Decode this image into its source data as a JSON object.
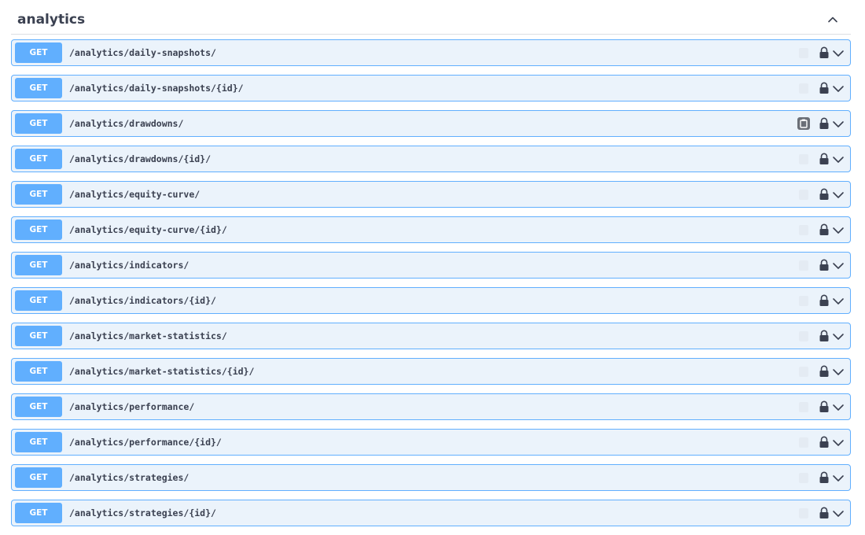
{
  "section": {
    "title": "analytics"
  },
  "operations": [
    {
      "method": "GET",
      "path": "/analytics/daily-snapshots/"
    },
    {
      "method": "GET",
      "path": "/analytics/daily-snapshots/{id}/"
    },
    {
      "method": "GET",
      "path": "/analytics/drawdowns/"
    },
    {
      "method": "GET",
      "path": "/analytics/drawdowns/{id}/"
    },
    {
      "method": "GET",
      "path": "/analytics/equity-curve/"
    },
    {
      "method": "GET",
      "path": "/analytics/equity-curve/{id}/"
    },
    {
      "method": "GET",
      "path": "/analytics/indicators/"
    },
    {
      "method": "GET",
      "path": "/analytics/indicators/{id}/"
    },
    {
      "method": "GET",
      "path": "/analytics/market-statistics/"
    },
    {
      "method": "GET",
      "path": "/analytics/market-statistics/{id}/"
    },
    {
      "method": "GET",
      "path": "/analytics/performance/"
    },
    {
      "method": "GET",
      "path": "/analytics/performance/{id}/"
    },
    {
      "method": "GET",
      "path": "/analytics/strategies/"
    },
    {
      "method": "GET",
      "path": "/analytics/strategies/{id}/"
    }
  ],
  "colors": {
    "get_method": "#61affe",
    "get_background": "#ebf3fb",
    "text": "#3b4151"
  },
  "icons": {
    "collapse": "chevron-up-icon",
    "copy": "clipboard-icon",
    "lock": "lock-icon",
    "expand": "chevron-down-icon"
  }
}
